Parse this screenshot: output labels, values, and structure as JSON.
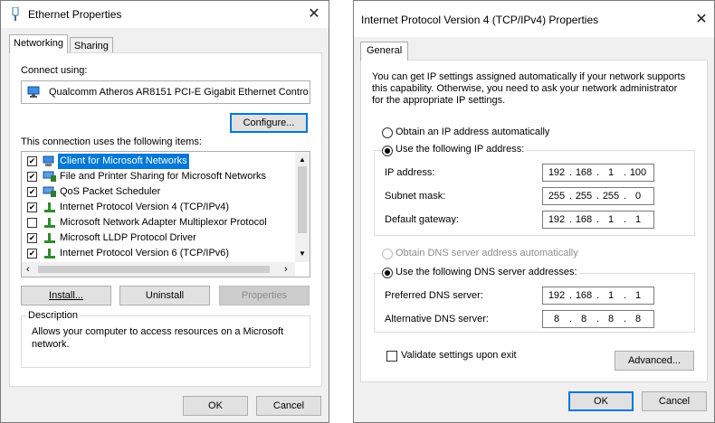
{
  "eth": {
    "title": "Ethernet Properties",
    "tabs": [
      "Networking",
      "Sharing"
    ],
    "connect_using_label": "Connect using:",
    "adapter": "Qualcomm Atheros AR8151 PCI-E Gigabit Ethernet Contro",
    "configure": "Configure...",
    "items_label": "This connection uses the following items:",
    "items": [
      {
        "label": "Client for Microsoft Networks",
        "checked": true,
        "selected": true,
        "icon": "network-client-icon"
      },
      {
        "label": "File and Printer Sharing for Microsoft Networks",
        "checked": true,
        "selected": false,
        "icon": "network-service-icon"
      },
      {
        "label": "QoS Packet Scheduler",
        "checked": true,
        "selected": false,
        "icon": "network-service-icon"
      },
      {
        "label": "Internet Protocol Version 4 (TCP/IPv4)",
        "checked": true,
        "selected": false,
        "icon": "protocol-icon"
      },
      {
        "label": "Microsoft Network Adapter Multiplexor Protocol",
        "checked": false,
        "selected": false,
        "icon": "protocol-icon"
      },
      {
        "label": "Microsoft LLDP Protocol Driver",
        "checked": true,
        "selected": false,
        "icon": "protocol-icon"
      },
      {
        "label": "Internet Protocol Version 6 (TCP/IPv6)",
        "checked": true,
        "selected": false,
        "icon": "protocol-icon"
      }
    ],
    "install": "Install...",
    "uninstall": "Uninstall",
    "properties": "Properties",
    "description_title": "Description",
    "description_text_1": "Allows your computer to access resources on a Microsoft",
    "description_text_2": "network.",
    "ok": "OK",
    "cancel": "Cancel"
  },
  "ipv4": {
    "title": "Internet Protocol Version 4 (TCP/IPv4) Properties",
    "tab": "General",
    "intro_1": "You can get IP settings assigned automatically if your network supports",
    "intro_2": "this capability. Otherwise, you need to ask your network administrator",
    "intro_3": "for the appropriate IP settings.",
    "obtain_ip": "Obtain an IP address automatically",
    "use_ip": "Use the following IP address:",
    "ip_label": "IP address:",
    "ip_value": [
      "192",
      "168",
      "1",
      "100"
    ],
    "subnet_label": "Subnet mask:",
    "subnet_value": [
      "255",
      "255",
      "255",
      "0"
    ],
    "gateway_label": "Default gateway:",
    "gateway_value": [
      "192",
      "168",
      "1",
      "1"
    ],
    "obtain_dns": "Obtain DNS server address automatically",
    "use_dns": "Use the following DNS server addresses:",
    "pref_dns_label": "Preferred DNS server:",
    "pref_dns_value": [
      "192",
      "168",
      "1",
      "1"
    ],
    "alt_dns_label": "Alternative DNS server:",
    "alt_dns_value": [
      "8",
      "8",
      "8",
      "8"
    ],
    "validate": "Validate settings upon exit",
    "advanced": "Advanced...",
    "ok": "OK",
    "cancel": "Cancel"
  },
  "colors": {
    "selection": "#0078d7",
    "accent": "#0078d7",
    "dialog_bg": "#f0f0f0"
  }
}
